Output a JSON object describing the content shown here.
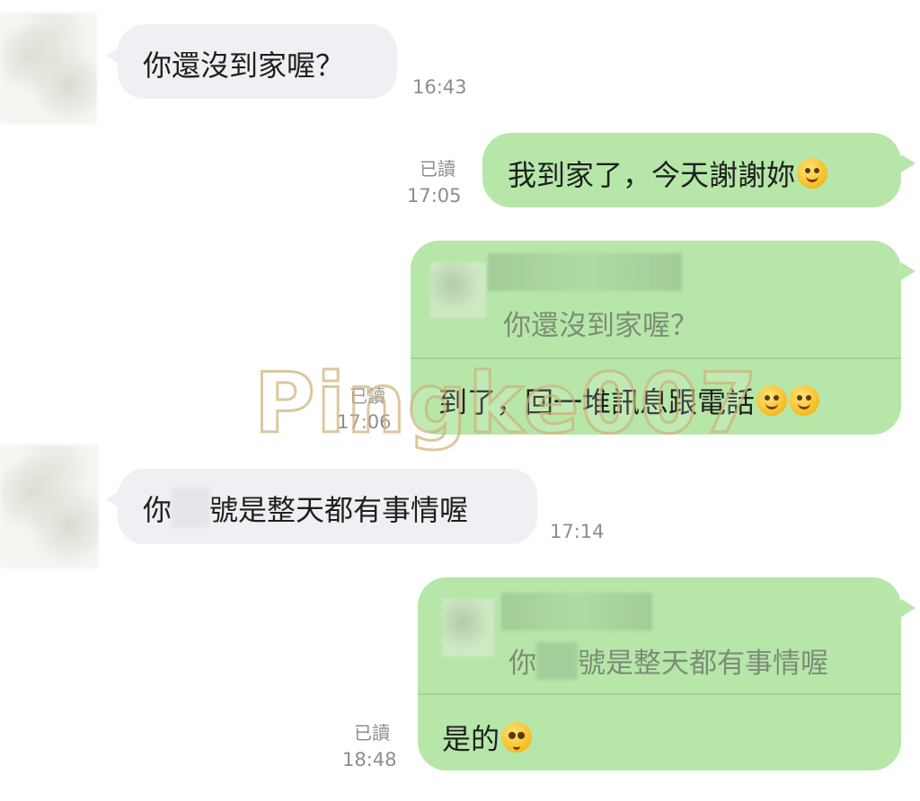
{
  "messages": [
    {
      "type": "received",
      "text": "你還沒到家喔？",
      "time": "16:43"
    },
    {
      "type": "sent",
      "read": "已讀",
      "time": "17:05",
      "text": "我到家了，今天謝謝妳",
      "emoji": "smiling-face-with-hearts-icon"
    },
    {
      "type": "sent_reply",
      "read": "已讀",
      "time": "17:06",
      "quote": "你還沒到家喔？",
      "text": "到了，回一堆訊息跟電話",
      "emoji": "rolling-on-floor-laughing-icon"
    },
    {
      "type": "received",
      "text_before": "你",
      "text_after": "號是整天都有事情喔",
      "time": "17:14"
    },
    {
      "type": "sent_reply",
      "read": "已讀",
      "time": "18:48",
      "quote_before": "你",
      "quote_after": "號是整天都有事情喔",
      "text": "是的",
      "emoji": "pleading-face-icon"
    }
  ],
  "watermark": "Pingke007",
  "colors": {
    "sent_bubble": "#b6e7a8",
    "received_bubble": "#eef0f3",
    "meta_text": "#8b8d90"
  }
}
